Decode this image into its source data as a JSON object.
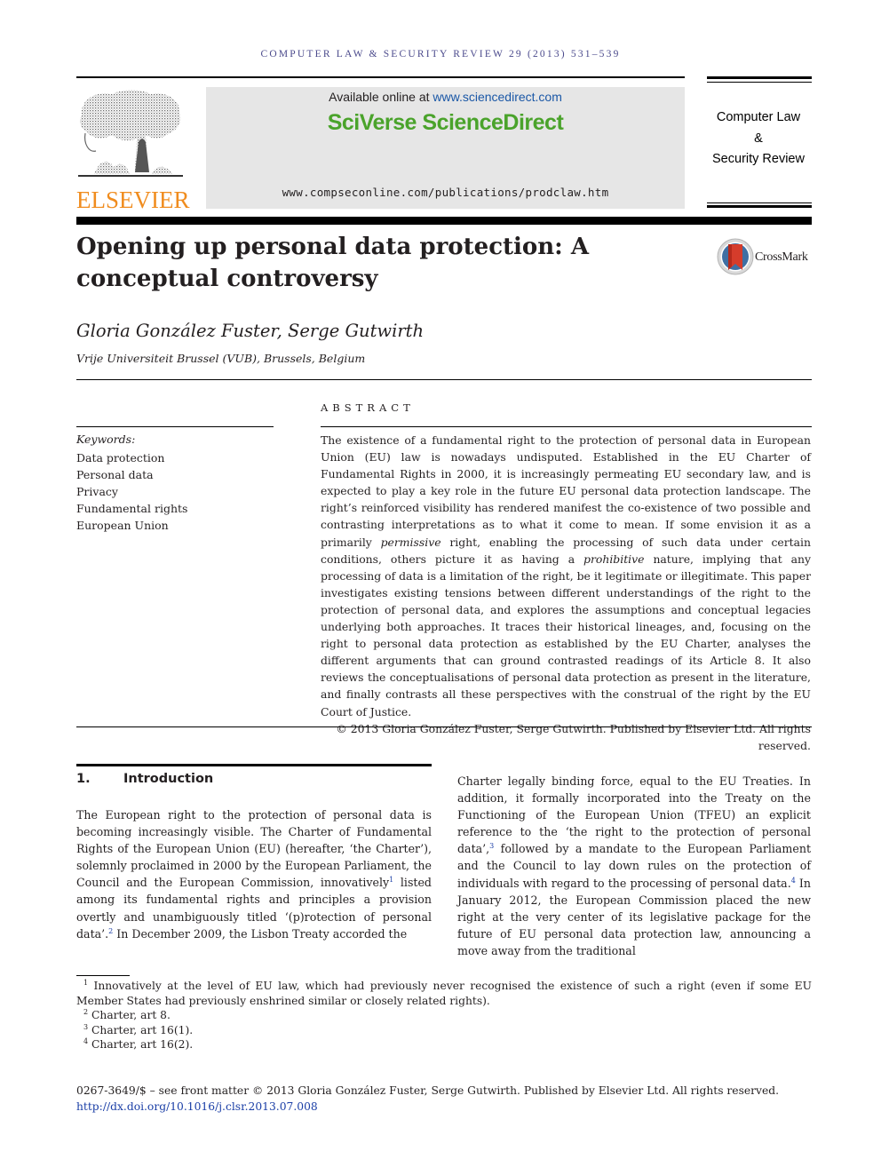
{
  "running_head": "COMPUTER LAW & SECURITY REVIEW 29 (2013) 531–539",
  "publisher": {
    "logo_word": "ELSEVIER",
    "brand_color": "#f08c1e"
  },
  "sciencedirect": {
    "available_prefix": "Available online at ",
    "available_link": "www.sciencedirect.com",
    "brand": "SciVerse ScienceDirect",
    "brand_color": "#4aa32b",
    "journal_url": "www.compseconline.com/publications/prodclaw.htm"
  },
  "journal_name": {
    "line1": "Computer Law",
    "line2": "&",
    "line3": "Security Review"
  },
  "article": {
    "title": "Opening up personal data protection: A conceptual controversy",
    "crossmark_label": "CrossMark",
    "authors": "Gloria González Fuster, Serge Gutwirth",
    "affiliation": "Vrije Universiteit Brussel (VUB), Brussels, Belgium"
  },
  "keywords": {
    "label": "Keywords:",
    "items": [
      "Data protection",
      "Personal data",
      "Privacy",
      "Fundamental rights",
      "European Union"
    ]
  },
  "abstract": {
    "heading": "ABSTRACT",
    "part1": "The existence of a fundamental right to the protection of personal data in European Union (EU) law is nowadays undisputed. Established in the EU Charter of Fundamental Rights in 2000, it is increasingly permeating EU secondary law, and is expected to play a key role in the future EU personal data protection landscape. The right’s reinforced visibility has rendered manifest the co-existence of two possible and contrasting interpretations as to what it come to mean. If some envision it as a primarily ",
    "em1": "permissive",
    "part2": " right, enabling the processing of such data under certain conditions, others picture it as having a ",
    "em2": "prohibitive",
    "part3": " nature, implying that any processing of data is a limitation of the right, be it legitimate or illegitimate. This paper investigates existing tensions between different understandings of the right to the protection of personal data, and explores the assumptions and conceptual legacies underlying both approaches. It traces their historical lineages, and, focusing on the right to personal data protection as established by the EU Charter, analyses the different arguments that can ground contrasted readings of its Article 8. It also reviews the conceptualisations of personal data protection as present in the literature, and finally contrasts all these perspectives with the construal of the right by the EU Court of Justice.",
    "copyright": "© 2013 Gloria González Fuster, Serge Gutwirth. Published by Elsevier Ltd. All rights reserved."
  },
  "section1": {
    "number": "1.",
    "title": "Introduction",
    "left": {
      "t1": "The European right to the protection of personal data is becoming increasingly visible. The Charter of Fundamental Rights of the European Union (EU) (hereafter, ‘the Charter’), solemnly proclaimed in 2000 by the European Parliament, the Council and the European Commission, innovatively",
      "fn1": "1",
      "t2": " listed among its fundamental rights and principles a provision overtly and unambiguously titled ‘(p)rotection of personal data’.",
      "fn2": "2",
      "t3": " In December 2009, the Lisbon Treaty accorded the"
    },
    "right": {
      "t1": "Charter legally binding force, equal to the EU Treaties. In addition, it formally incorporated into the Treaty on the Functioning of the European Union (TFEU) an explicit reference to the ‘the right to the protection of personal data’,",
      "fn3": "3",
      "t2": " followed by a mandate to the European Parliament and the Council to lay down rules on the protection of individuals with regard to the processing of personal data.",
      "fn4": "4",
      "t3": " In January 2012, the European Commission placed the new right at the very center of its legislative package for the future of EU personal data protection law, announcing a move away from the traditional"
    }
  },
  "footnotes": [
    {
      "num": "1",
      "text": "Innovatively at the level of EU law, which had previously never recognised the existence of such a right (even if some EU Member States had previously enshrined similar or closely related rights)."
    },
    {
      "num": "2",
      "text": "Charter, art 8."
    },
    {
      "num": "3",
      "text": "Charter, art 16(1)."
    },
    {
      "num": "4",
      "text": "Charter, art 16(2)."
    }
  ],
  "front_matter": {
    "issn_line": "0267-3649/$ – see front matter © 2013 Gloria González Fuster, Serge Gutwirth. Published by Elsevier Ltd. All rights reserved.",
    "doi": "http://dx.doi.org/10.1016/j.clsr.2013.07.008"
  }
}
